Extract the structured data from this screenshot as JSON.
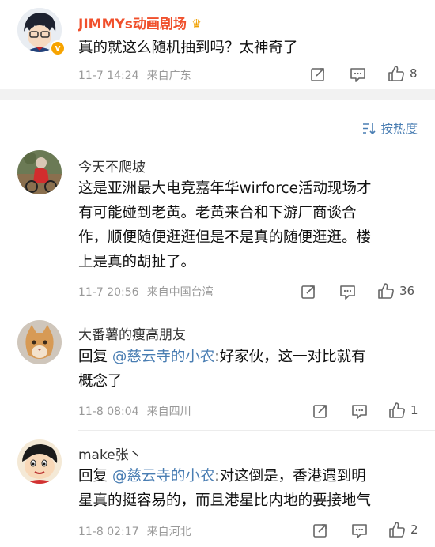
{
  "post": {
    "author": "JIMMYs动画剧场",
    "author_badge": "v",
    "text": "真的就这么随机抽到吗？太神奇了",
    "time": "11-7 14:24",
    "source": "来自广东",
    "likes": "8"
  },
  "sort": {
    "label": "按热度"
  },
  "comments": [
    {
      "author": "今天不爬坡",
      "lines": [
        "这是亚洲最大电竞嘉年华wirforce活动现场才",
        "有可能碰到老黄。老黄来台和下游厂商谈合",
        "作，顺便随便逛逛但是不是真的随便逛逛。楼",
        "上是真的胡扯了。"
      ],
      "time": "11-7 20:56",
      "source": "来自中国台湾",
      "likes": "36"
    },
    {
      "author": "大番薯的瘦高朋友",
      "reply_prefix": "回复",
      "mention": "@慈云寺的小农",
      "lines_after": [
        ":好家伙，这一对比就有",
        "概念了"
      ],
      "time": "11-8 08:04",
      "source": "来自四川",
      "likes": "1"
    },
    {
      "author": "make张丶",
      "reply_prefix": "回复",
      "mention": "@慈云寺的小农",
      "lines_after": [
        ":对这倒是，香港遇到明",
        "星真的挺容易的，而且港星比内地的要接地气"
      ],
      "time": "11-8 02:17",
      "source": "来自河北",
      "likes": "2"
    }
  ],
  "colors": {
    "accent": "#4a7eb3",
    "vip_name": "#f0502c",
    "separator": "#f2f2f2"
  },
  "icons": [
    "share-icon",
    "comment-icon",
    "like-icon",
    "sort-icon",
    "crown-icon"
  ]
}
